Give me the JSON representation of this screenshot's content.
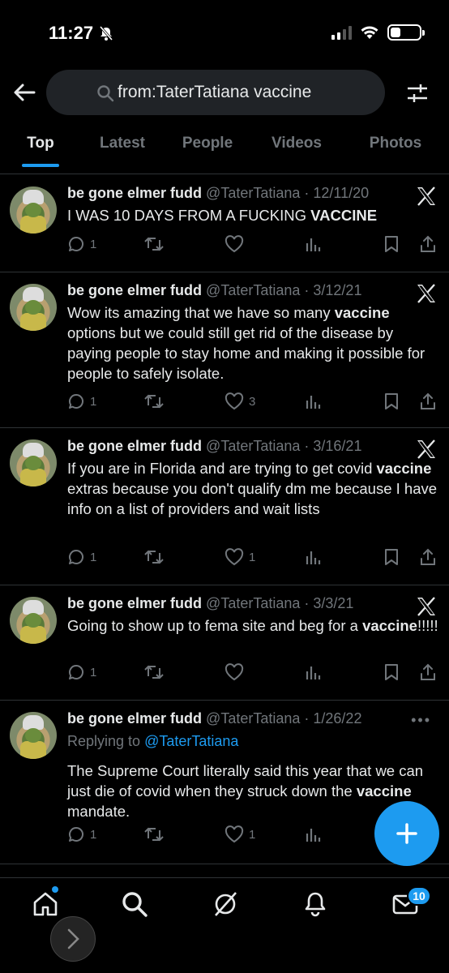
{
  "status": {
    "time": "11:27"
  },
  "search": {
    "query": "from:TaterTatiana vaccine"
  },
  "tabs": [
    "Top",
    "Latest",
    "People",
    "Videos",
    "Photos"
  ],
  "tweets": [
    {
      "name": "be gone elmer fudd",
      "handle": "@TaterTatiana",
      "date": "· 12/11/20",
      "pre": "I WAS 10 DAYS FROM A FUCKING ",
      "bold": "VACCINE",
      "post": "",
      "replies": "1",
      "retweets": "",
      "likes": ""
    },
    {
      "name": "be gone elmer fudd",
      "handle": "@TaterTatiana",
      "date": "· 3/12/21",
      "pre": "Wow its amazing that we have so many ",
      "bold": "vaccine",
      "post": " options but we could still get rid of the disease by paying people to stay home and making it possible for people to safely isolate.",
      "replies": "1",
      "retweets": "",
      "likes": "3"
    },
    {
      "name": "be gone elmer fudd",
      "handle": "@TaterTatiana",
      "date": "· 3/16/21",
      "pre": "If you are in Florida and are trying to get covid ",
      "bold": "vaccine",
      "post": " extras because you don't qualify dm me because I have info on a list of providers and wait lists",
      "replies": "1",
      "retweets": "",
      "likes": "1"
    },
    {
      "name": "be gone elmer fudd",
      "handle": "@TaterTatiana",
      "date": "· 3/3/21",
      "pre": "Going to show up to fema site and beg for a ",
      "bold": "vaccine",
      "post": "!!!!!",
      "replies": "1",
      "retweets": "",
      "likes": ""
    },
    {
      "name": "be gone elmer fudd",
      "handle": "@TaterTatiana",
      "date": "· 1/26/22",
      "replying_prefix": "Replying to ",
      "replying_to": "@TaterTatiana",
      "pre": "The Supreme Court literally said this year that we can just die of covid when they struck down the ",
      "bold": "vaccine",
      "post": " mandate.",
      "replies": "1",
      "retweets": "",
      "likes": "1"
    }
  ],
  "nav": {
    "messages_badge": "10"
  },
  "colors": {
    "accent": "#1d9bf0",
    "background": "#000000",
    "muted": "#71767b"
  }
}
